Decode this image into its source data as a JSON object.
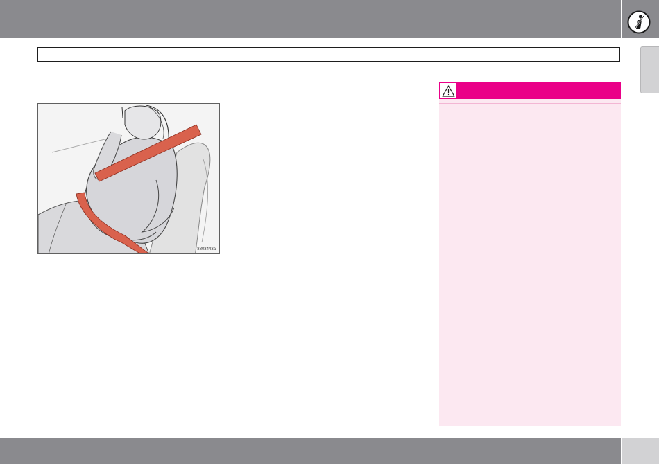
{
  "header": {
    "section_icon": "seatbelt-person-icon"
  },
  "section_title": "",
  "figure": {
    "code": "8803443a",
    "illustration": "pregnant-woman-seatbelt-illustration"
  },
  "warning": {
    "icon": "warning-triangle-icon",
    "title": ""
  },
  "footer": {
    "page_number": ""
  },
  "colors": {
    "bar_gray": "#8a8a8e",
    "tab_gray": "#d2d2d4",
    "warning_magenta": "#ea0088",
    "warning_bg": "#fce8f1",
    "belt_red": "#d9624d"
  }
}
